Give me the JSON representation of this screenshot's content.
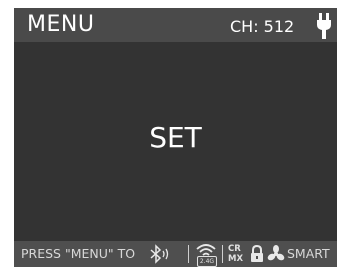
{
  "header": {
    "title": "MENU",
    "channel": "CH: 512"
  },
  "main": {
    "label": "SET"
  },
  "footer": {
    "hint": "PRESS \"MENU\" TO",
    "band_badge": "2.4G",
    "cr_mx": "CR\nMX",
    "smart_label": "SMART"
  },
  "icons": {
    "power": "plug-icon",
    "bluetooth": "bluetooth-icon",
    "wireless": "wireless-icon",
    "lock": "lock-icon",
    "fan": "fan-icon"
  },
  "colors": {
    "screen": "#333333",
    "header_bar": "#4a4a4a",
    "footer_bar": "#4f4f4f",
    "text": "#ffffff"
  }
}
